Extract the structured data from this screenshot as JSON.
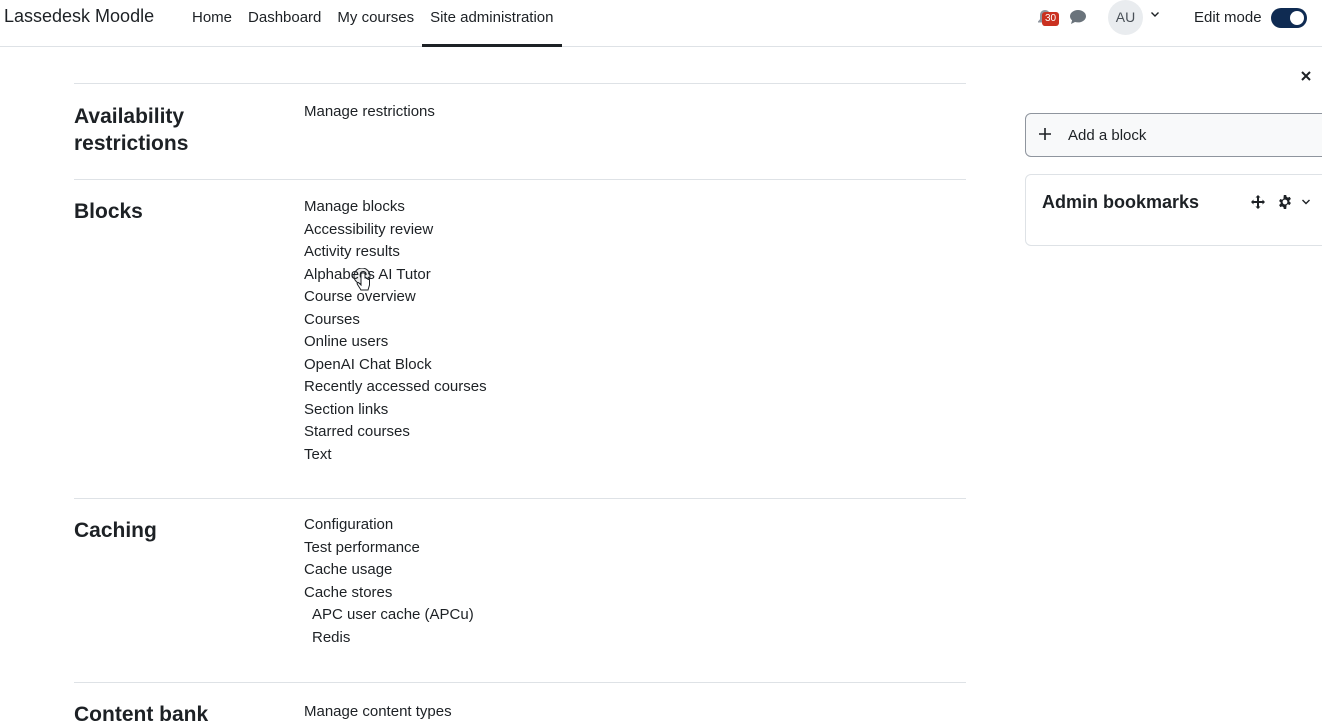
{
  "navbar": {
    "brand": "Lassedesk Moodle",
    "links": [
      {
        "label": "Home"
      },
      {
        "label": "Dashboard"
      },
      {
        "label": "My courses"
      },
      {
        "label": "Site administration"
      }
    ],
    "notification_count": "30",
    "avatar_initials": "AU",
    "edit_mode_label": "Edit mode",
    "edit_mode_on": true
  },
  "sections": {
    "availability": {
      "title": "Availability restrictions",
      "links": [
        "Manage restrictions"
      ]
    },
    "blocks": {
      "title": "Blocks",
      "links": [
        "Manage blocks",
        "Accessibility review",
        "Activity results",
        "Alphabees AI Tutor",
        "Course overview",
        "Courses",
        "Online users",
        "OpenAI Chat Block",
        "Recently accessed courses",
        "Section links",
        "Starred courses",
        "Text"
      ]
    },
    "caching": {
      "title": "Caching",
      "links": [
        "Configuration",
        "Test performance",
        "Cache usage",
        "Cache stores",
        "APC user cache (APCu)",
        "Redis"
      ]
    },
    "content": {
      "title": "Content bank",
      "links": [
        "Manage content types"
      ]
    }
  },
  "drawer": {
    "add_block_label": "Add a block",
    "bookmarks_title": "Admin bookmarks"
  },
  "colors": {
    "accent": "#0f2b52",
    "badge": "#ca3120",
    "text": "#1d2125"
  }
}
